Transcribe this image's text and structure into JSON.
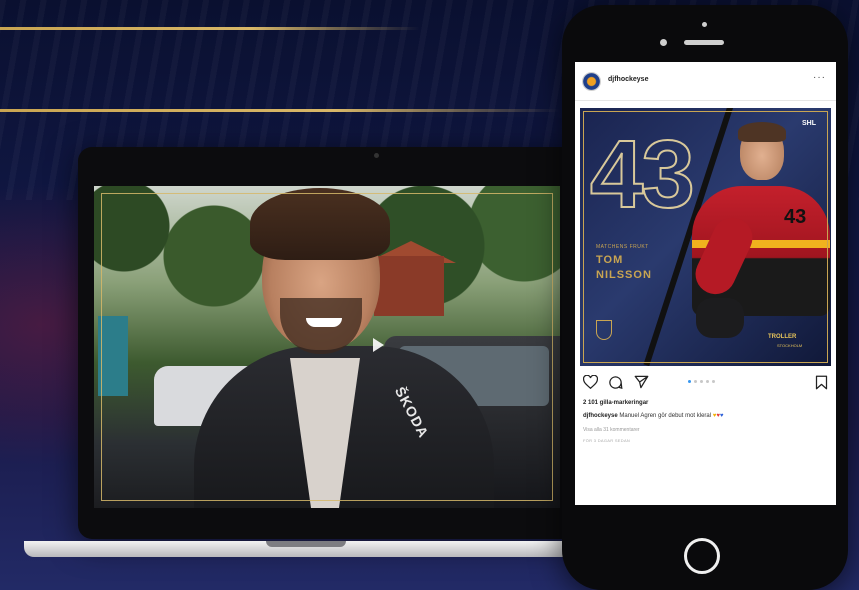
{
  "instagram_post": {
    "username": "djfhockeyse",
    "more_label": "···",
    "post_image": {
      "jersey_number_big": "43",
      "league": "SHL",
      "subtitle": "MATCHENS FRUKT",
      "player_first_name": "TOM",
      "player_last_name": "NILSSON",
      "jersey_number_small": "43",
      "team_name": "TROLLER",
      "team_sub": "STOCKHOLM"
    },
    "carousel": {
      "total": 5,
      "active": 0
    },
    "likes": "2 101 gilla-markeringar",
    "caption_user": "djfhockeyse",
    "caption_text": "Manuel Agren gör debut mot kleral",
    "caption_emojis": [
      "♥",
      "♥",
      "♥"
    ],
    "comments_link": "Visa alla 31 kommentarer",
    "timestamp": "FÖR 3 DAGAR SEDAN"
  },
  "video": {
    "shirt_brand": "ŠKODA"
  },
  "colors": {
    "gold": "#c9a552",
    "background_navy": "#111845",
    "like_blue": "#3897f0"
  },
  "icons": [
    "heart-icon",
    "comment-icon",
    "share-icon",
    "bookmark-icon",
    "play-icon"
  ]
}
